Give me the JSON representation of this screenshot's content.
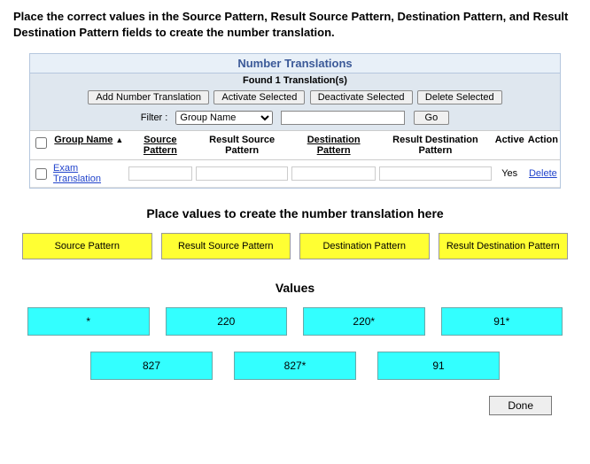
{
  "instructions": "Place the correct values in the Source Pattern, Result Source Pattern, Destination Pattern, and Result Destination Pattern fields to create the number translation.",
  "panel": {
    "title": "Number Translations",
    "found_text": "Found 1 Translation(s)",
    "buttons": {
      "add": "Add Number Translation",
      "activate": "Activate Selected",
      "deactivate": "Deactivate Selected",
      "delete": "Delete Selected"
    },
    "filter": {
      "label": "Filter  :",
      "selected": "Group Name",
      "value": "",
      "go": "Go"
    },
    "columns": {
      "group_name": "Group Name",
      "source_pattern": "Source Pattern",
      "result_source_pattern": "Result Source Pattern",
      "destination_pattern": "Destination Pattern",
      "result_destination_pattern": "Result Destination Pattern",
      "active": "Active",
      "action": "Action"
    },
    "rows": [
      {
        "group_name": "Exam Translation",
        "source_pattern": "",
        "result_source_pattern": "",
        "destination_pattern": "",
        "result_destination_pattern": "",
        "active": "Yes",
        "action": "Delete"
      }
    ]
  },
  "drop_heading": "Place values to create the number translation here",
  "slots": {
    "source": "Source Pattern",
    "result_source": "Result Source Pattern",
    "destination": "Destination Pattern",
    "result_destination": "Result Destination Pattern"
  },
  "values_heading": "Values",
  "values_row1": [
    "*",
    "220",
    "220*",
    "91*"
  ],
  "values_row2": [
    "827",
    "827*",
    "91"
  ],
  "done": "Done"
}
